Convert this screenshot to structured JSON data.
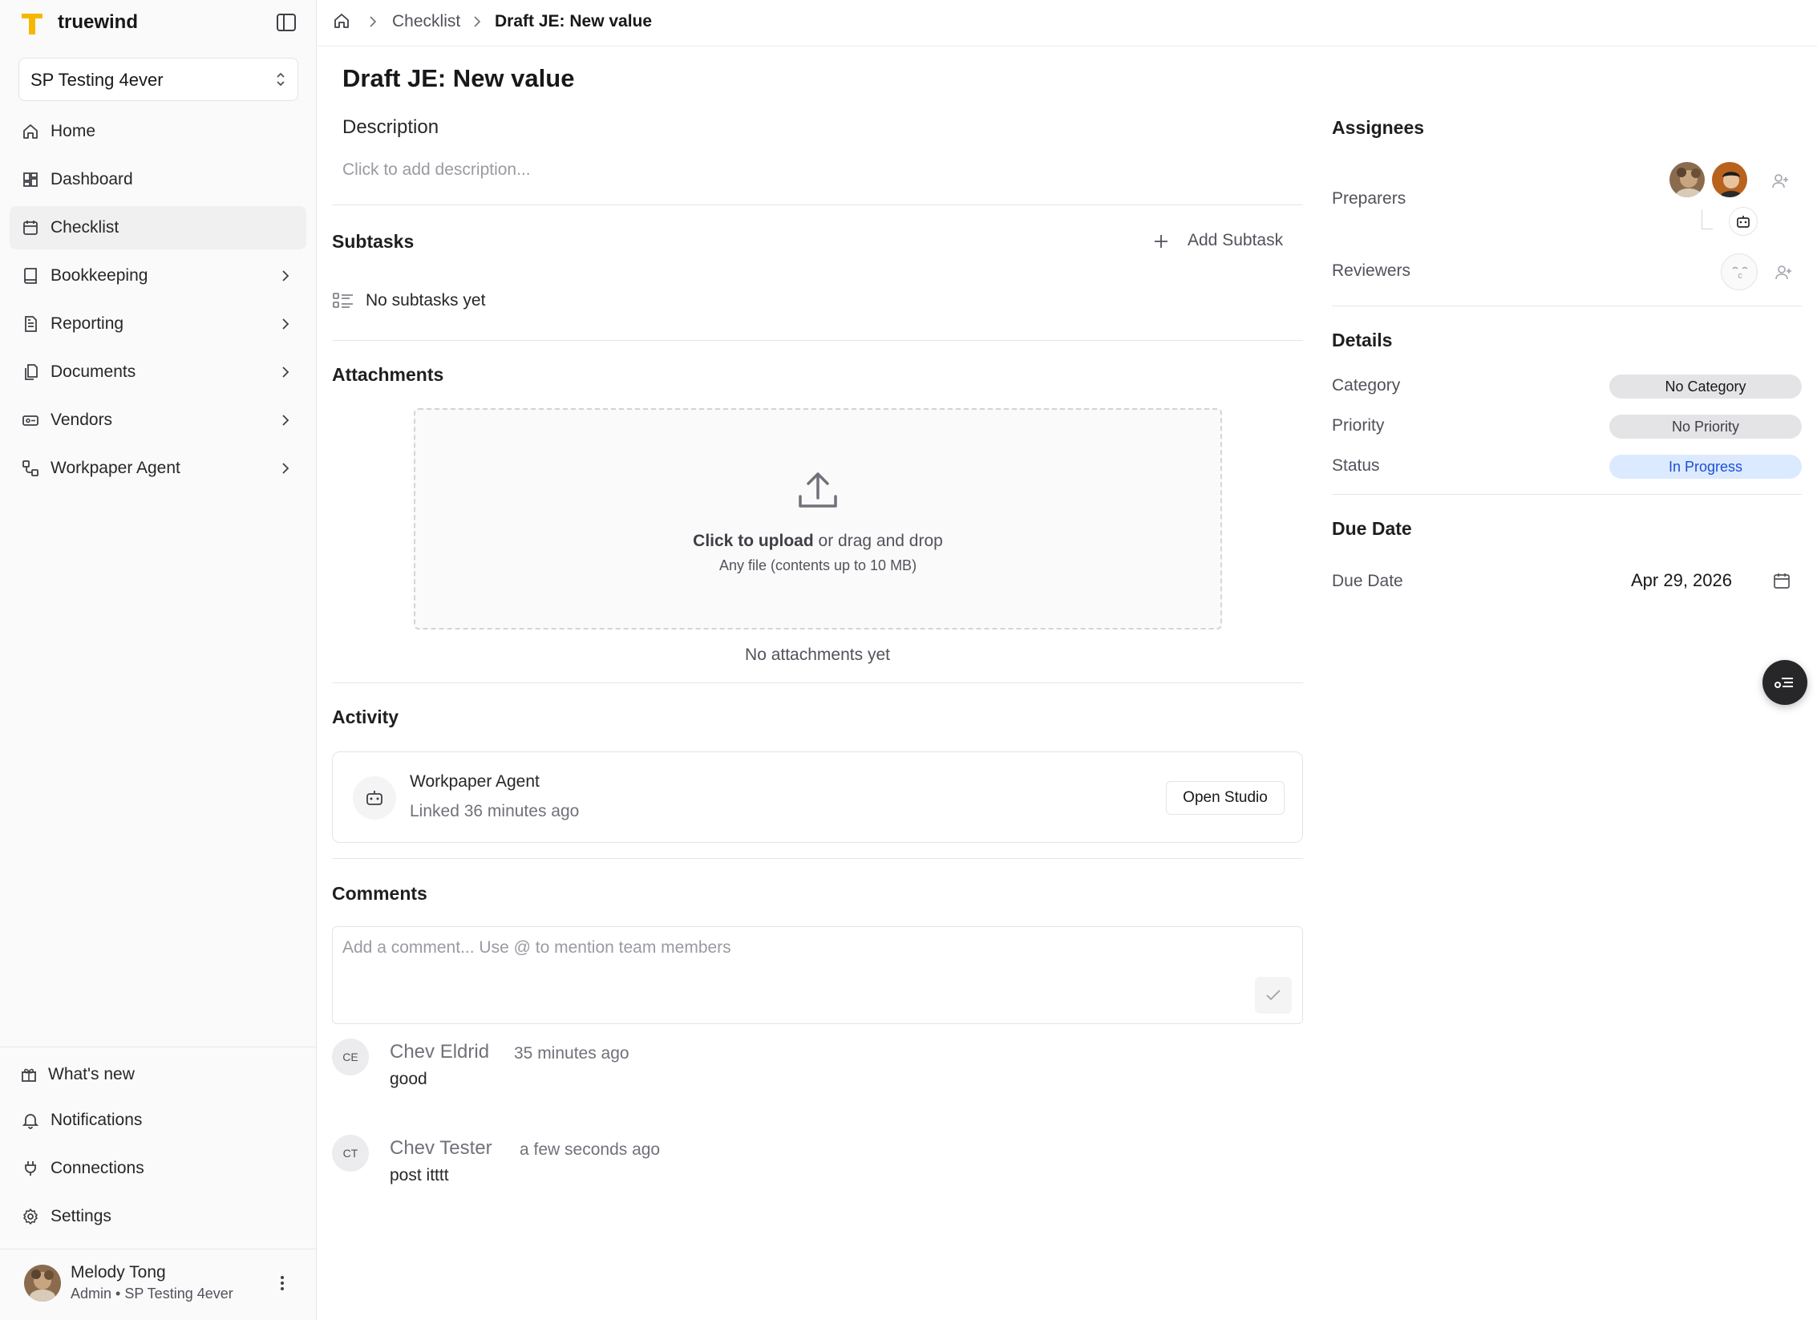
{
  "app": {
    "name": "truewind"
  },
  "sidebar": {
    "workspace": "SP Testing 4ever",
    "items": [
      {
        "label": "Home",
        "icon": "home-icon"
      },
      {
        "label": "Dashboard",
        "icon": "dashboard-icon"
      },
      {
        "label": "Checklist",
        "icon": "calendar-check-icon",
        "active": true
      },
      {
        "label": "Bookkeeping",
        "icon": "book-icon",
        "has_children": true
      },
      {
        "label": "Reporting",
        "icon": "report-icon",
        "has_children": true
      },
      {
        "label": "Documents",
        "icon": "documents-icon",
        "has_children": true
      },
      {
        "label": "Vendors",
        "icon": "vendor-card-icon",
        "has_children": true
      },
      {
        "label": "Workpaper Agent",
        "icon": "workflow-icon",
        "has_children": true
      }
    ],
    "bottom_items": [
      {
        "label": "What's new",
        "icon": "gift-icon"
      },
      {
        "label": "Notifications",
        "icon": "bell-icon"
      },
      {
        "label": "Connections",
        "icon": "plug-icon"
      },
      {
        "label": "Settings",
        "icon": "gear-icon"
      }
    ],
    "user": {
      "name": "Melody Tong",
      "role": "Admin • SP Testing 4ever"
    }
  },
  "breadcrumb": {
    "items": [
      "Checklist",
      "Draft JE: New value"
    ]
  },
  "task": {
    "title": "Draft JE: New value",
    "description": {
      "heading": "Description",
      "placeholder": "Click to add description..."
    },
    "subtasks": {
      "heading": "Subtasks",
      "add_label": "Add Subtask",
      "empty": "No subtasks yet"
    },
    "attachments": {
      "heading": "Attachments",
      "upload_bold": "Click to upload",
      "upload_rest": "or drag and drop",
      "hint": "Any file (contents up to 10 MB)",
      "empty": "No attachments yet"
    },
    "activity": {
      "heading": "Activity",
      "items": [
        {
          "title": "Workpaper Agent",
          "subtitle": "Linked 36 minutes ago",
          "action": "Open Studio"
        }
      ]
    },
    "comments": {
      "heading": "Comments",
      "placeholder": "Add a comment... Use @ to mention team members",
      "items": [
        {
          "initials": "CE",
          "author": "Chev Eldrid",
          "time": "35 minutes ago",
          "text": "good"
        },
        {
          "initials": "CT",
          "author": "Chev Tester",
          "time": "a few seconds ago",
          "text": "post itttt"
        }
      ]
    }
  },
  "right_panel": {
    "assignees": {
      "heading": "Assignees",
      "preparers_label": "Preparers",
      "reviewers_label": "Reviewers"
    },
    "details": {
      "heading": "Details",
      "rows": [
        {
          "label": "Category",
          "value": "No Category",
          "color": "#e4e4e7"
        },
        {
          "label": "Priority",
          "value": "No Priority",
          "color": "#e4e4e7"
        },
        {
          "label": "Status",
          "value": "In Progress",
          "color": "#dbeafe"
        }
      ]
    },
    "due_date": {
      "heading": "Due Date",
      "label": "Due Date",
      "value": "Apr 29, 2026"
    }
  },
  "colors": {
    "brand": "#f5b800",
    "status_in_progress_text": "#1d4ed8",
    "sidebar_bg": "#fafafa"
  }
}
